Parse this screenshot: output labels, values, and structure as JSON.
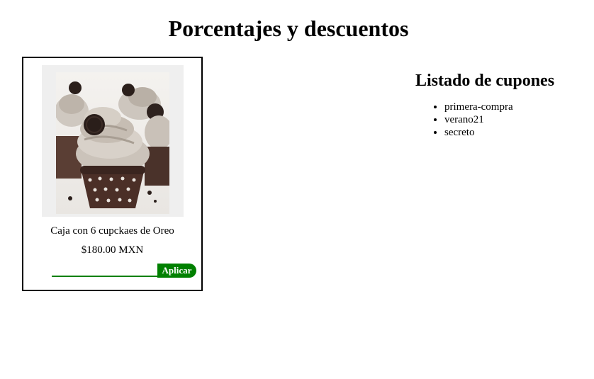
{
  "header": {
    "title": "Porcentajes y descuentos"
  },
  "product": {
    "image_icon": "oreo-cupcakes-photo",
    "name": "Caja con 6 cupckaes de Oreo",
    "price": "$180.00 MXN",
    "coupon_input_value": "",
    "coupon_input_placeholder": "",
    "apply_label": "Aplicar"
  },
  "coupons": {
    "title": "Listado de cupones",
    "items": [
      "primera-compra",
      "verano21",
      "secreto"
    ]
  },
  "colors": {
    "accent": "#008000",
    "border": "#000000",
    "background": "#ffffff"
  }
}
